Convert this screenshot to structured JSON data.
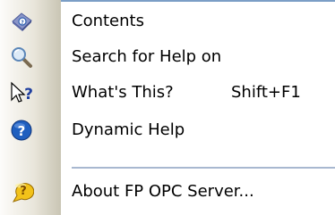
{
  "menu": {
    "items": [
      {
        "label": "Contents",
        "shortcut": "",
        "icon": "help-contents-book-icon"
      },
      {
        "label": "Search for Help on",
        "shortcut": "",
        "icon": "magnifier-search-icon"
      },
      {
        "label": "What's This?",
        "shortcut": "Shift+F1",
        "icon": "whats-this-arrow-question-icon"
      },
      {
        "label": "Dynamic Help",
        "shortcut": "",
        "icon": "blue-question-circle-icon"
      },
      {
        "label": "About FP OPC Server...",
        "shortcut": "",
        "icon": "yellow-question-bubble-icon"
      }
    ]
  },
  "colors": {
    "strip_light": "#fdfcfa",
    "strip_dark": "#c9c5b4",
    "border": "#7b9ec6",
    "separator": "#a8b8d0",
    "help_blue": "#1f5fbf",
    "help_yellow": "#f2c21a"
  }
}
